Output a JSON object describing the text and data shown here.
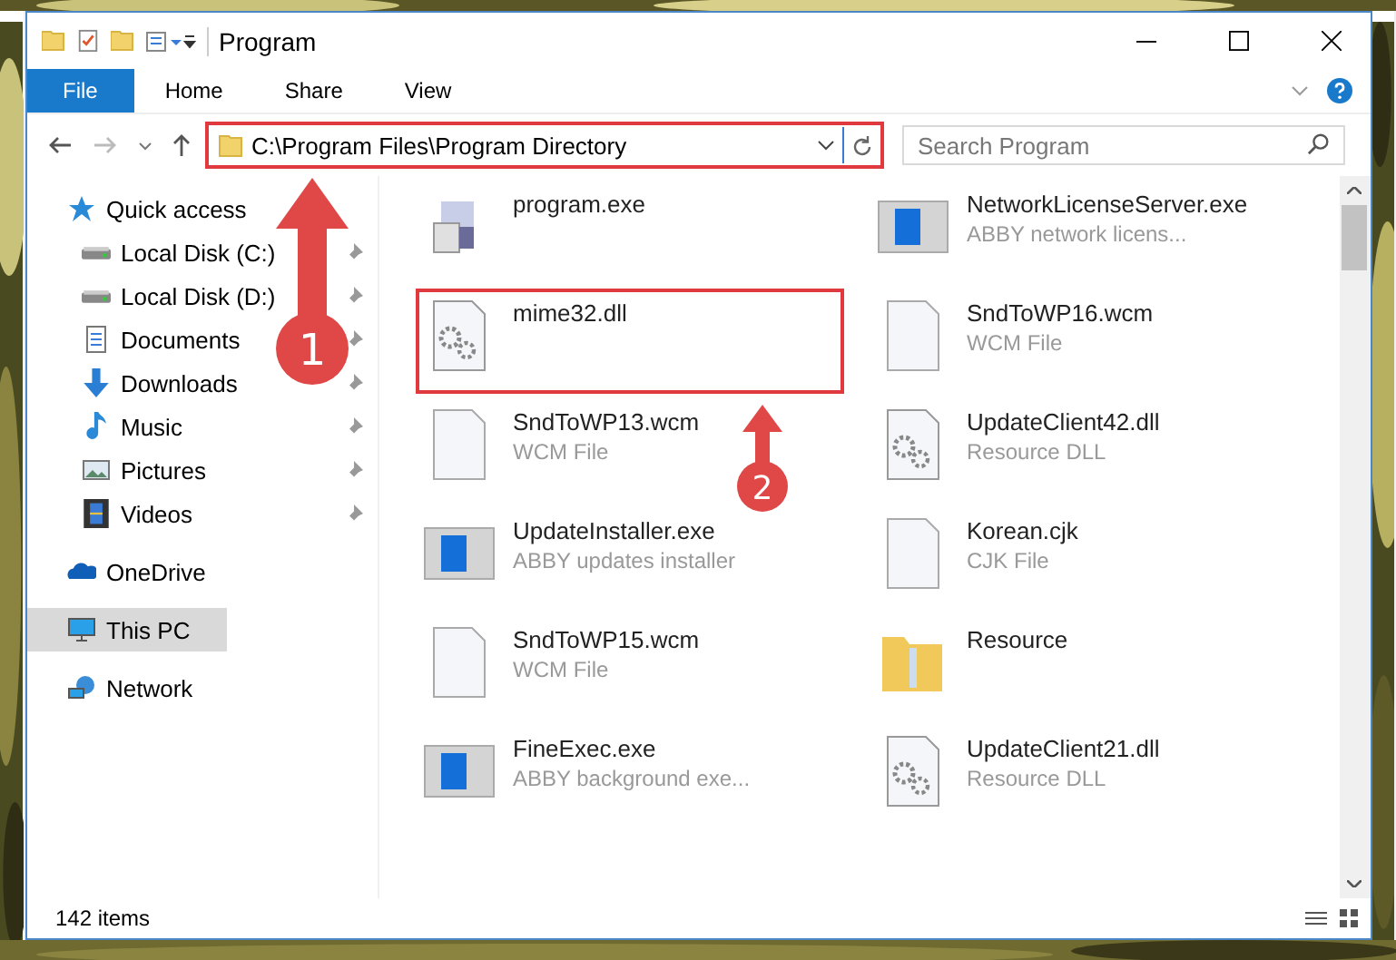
{
  "window": {
    "title": "Program"
  },
  "ribbon_tabs": [
    {
      "label": "File",
      "selected": true
    },
    {
      "label": "Home",
      "selected": false
    },
    {
      "label": "Share",
      "selected": false
    },
    {
      "label": "View",
      "selected": false
    }
  ],
  "address_bar": {
    "path": "C:\\Program Files\\Program Directory",
    "highlighted": true
  },
  "search": {
    "placeholder": "Search Program"
  },
  "sidebar": {
    "items": [
      {
        "label": "Quick access",
        "pinned": false,
        "selected": false
      },
      {
        "label": "Local Disk (C:)",
        "pinned": true,
        "selected": false
      },
      {
        "label": "Local Disk (D:)",
        "pinned": true,
        "selected": false
      },
      {
        "label": "Documents",
        "pinned": true,
        "selected": false
      },
      {
        "label": "Downloads",
        "pinned": true,
        "selected": false
      },
      {
        "label": "Music",
        "pinned": true,
        "selected": false
      },
      {
        "label": "Pictures",
        "pinned": true,
        "selected": false
      },
      {
        "label": "Videos",
        "pinned": true,
        "selected": false
      },
      {
        "label": "OneDrive",
        "pinned": false,
        "selected": false
      },
      {
        "label": "This PC",
        "pinned": false,
        "selected": true
      },
      {
        "label": "Network",
        "pinned": false,
        "selected": false
      }
    ]
  },
  "files": [
    {
      "name": "program.exe",
      "highlighted": false
    },
    {
      "name": "NetworkLicenseServer.exe",
      "type": "ABBY network licens...",
      "highlighted": false
    },
    {
      "name": "mime32.dll",
      "highlighted": true
    },
    {
      "name": "SndToWP16.wcm",
      "type": "WCM File",
      "highlighted": false
    },
    {
      "name": "SndToWP13.wcm",
      "type": "WCM File",
      "highlighted": false
    },
    {
      "name": "UpdateClient42.dll",
      "type": "Resource DLL",
      "highlighted": false
    },
    {
      "name": "UpdateInstaller.exe",
      "type": "ABBY updates installer",
      "highlighted": false
    },
    {
      "name": "Korean.cjk",
      "type": "CJK File",
      "highlighted": false
    },
    {
      "name": "SndToWP15.wcm",
      "type": "WCM File",
      "highlighted": false
    },
    {
      "name": "Resource",
      "highlighted": false
    },
    {
      "name": "FineExec.exe",
      "type": "ABBY background exe...",
      "highlighted": false
    },
    {
      "name": "UpdateClient21.dll",
      "type": "Resource DLL",
      "highlighted": false
    }
  ],
  "status_bar": {
    "count": "142 items"
  },
  "annotations": [
    {
      "number": "1"
    },
    {
      "number": "2"
    }
  ]
}
